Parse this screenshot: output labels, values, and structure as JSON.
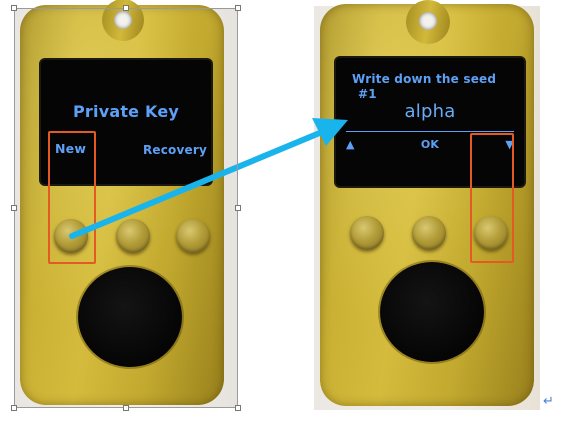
{
  "left_device": {
    "screen_title": "Private Key",
    "option_left": "New",
    "option_right": "Recovery"
  },
  "right_device": {
    "heading": "Write down the seed",
    "index": "#1",
    "word": "alpha",
    "nav_up": "▲",
    "nav_ok": "OK",
    "nav_down": "▼"
  },
  "annotations": {
    "highlight_color": "#e35a22",
    "arrow_color": "#1ab4ec",
    "screen_text_color": "#5da0f5"
  },
  "editor": {
    "paragraph_mark": "↵"
  }
}
